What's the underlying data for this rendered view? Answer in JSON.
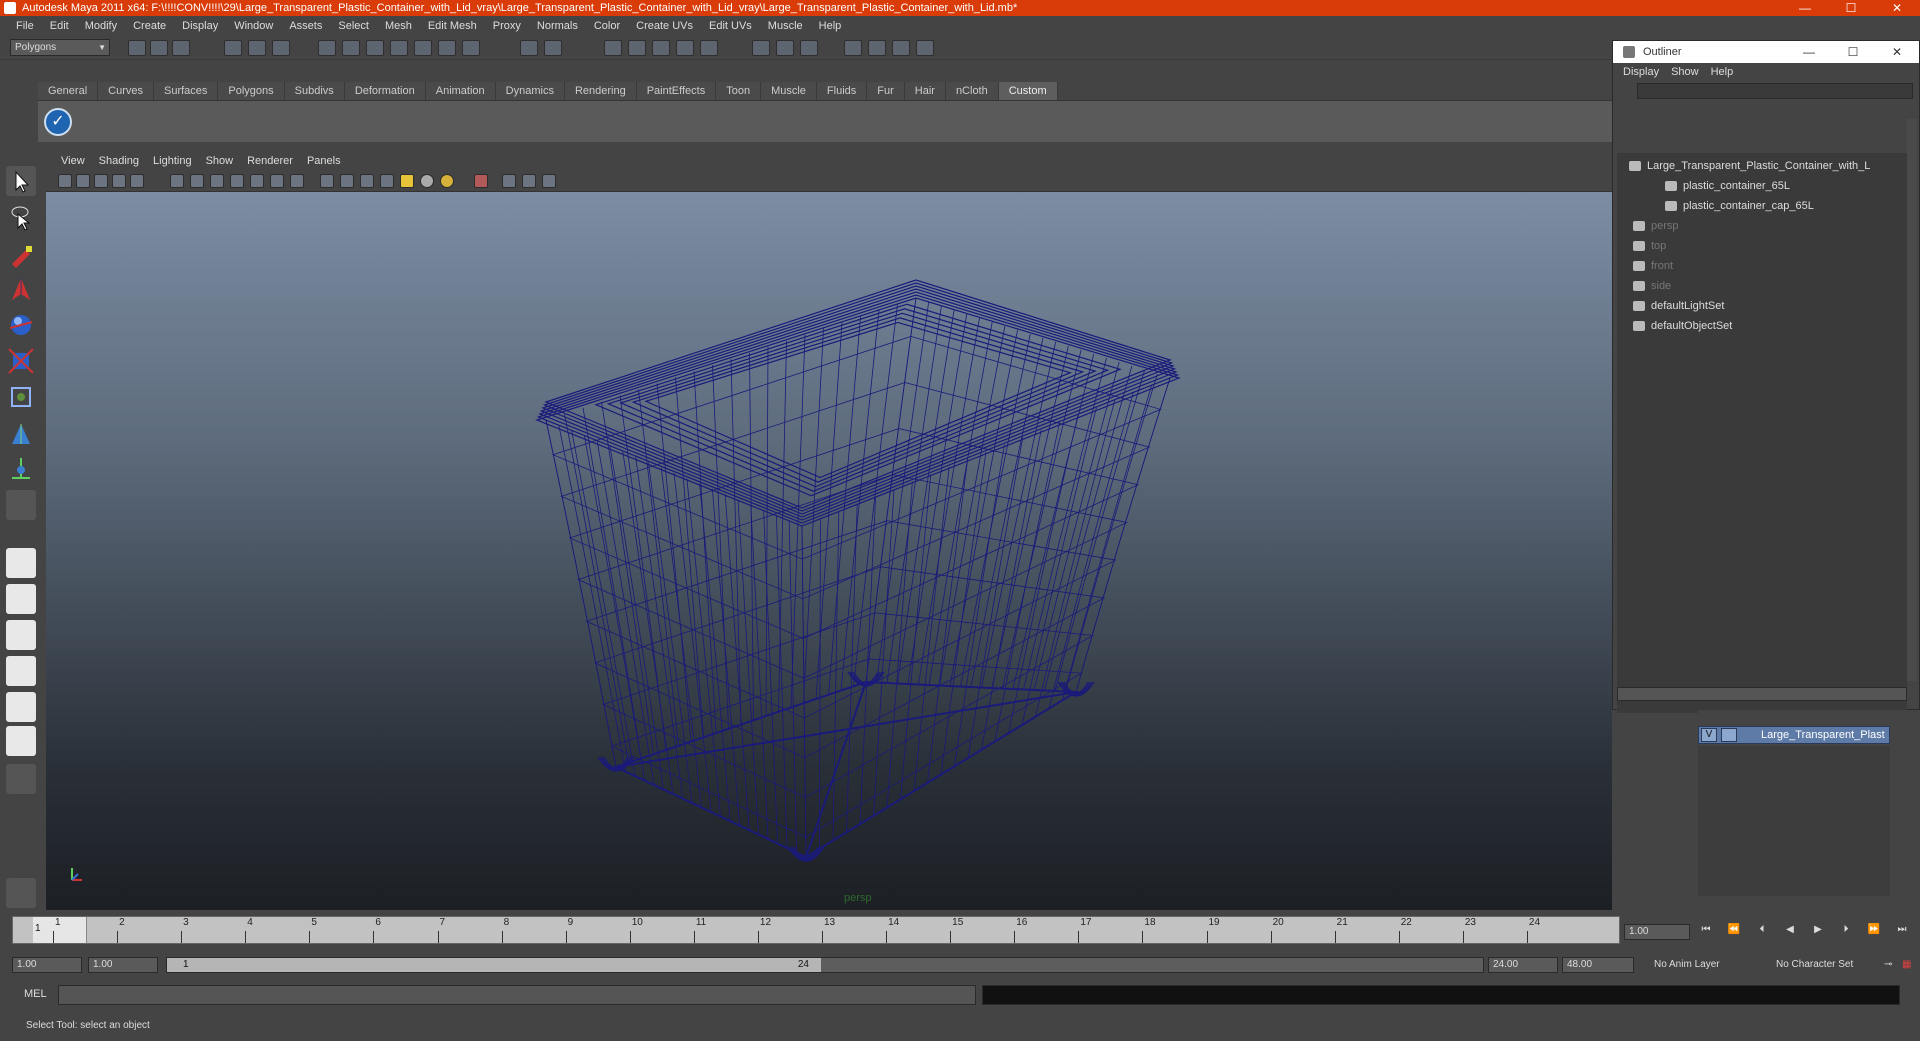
{
  "window": {
    "title": "Autodesk Maya 2011 x64: F:\\!!!!CONV!!!!\\29\\Large_Transparent_Plastic_Container_with_Lid_vray\\Large_Transparent_Plastic_Container_with_Lid_vray\\Large_Transparent_Plastic_Container_with_Lid.mb*",
    "controls": [
      "—",
      "☐",
      "✕"
    ]
  },
  "menubar": [
    "File",
    "Edit",
    "Modify",
    "Create",
    "Display",
    "Window",
    "Assets",
    "Select",
    "Mesh",
    "Edit Mesh",
    "Proxy",
    "Normals",
    "Color",
    "Create UVs",
    "Edit UVs",
    "Muscle",
    "Help"
  ],
  "statusline": {
    "mode": "Polygons"
  },
  "shelf": {
    "tabs": [
      "General",
      "Curves",
      "Surfaces",
      "Polygons",
      "Subdivs",
      "Deformation",
      "Animation",
      "Dynamics",
      "Rendering",
      "PaintEffects",
      "Toon",
      "Muscle",
      "Fluids",
      "Fur",
      "Hair",
      "nCloth",
      "Custom"
    ],
    "active_tab": "Custom",
    "icons": [
      "check-icon"
    ]
  },
  "panel": {
    "menus": [
      "View",
      "Shading",
      "Lighting",
      "Show",
      "Renderer",
      "Panels"
    ],
    "camera_label": "persp",
    "wire_color": "#1a1a7a"
  },
  "outliner": {
    "title": "Outliner",
    "menus": [
      "Display",
      "Show",
      "Help"
    ],
    "items": [
      {
        "label": "Large_Transparent_Plastic_Container_with_L",
        "icon": "group-icon",
        "dim": false
      },
      {
        "label": "plastic_container_65L",
        "icon": "mesh-icon",
        "dim": false
      },
      {
        "label": "plastic_container_cap_65L",
        "icon": "mesh-icon",
        "dim": false
      },
      {
        "label": "persp",
        "icon": "camera-icon",
        "dim": true
      },
      {
        "label": "top",
        "icon": "camera-icon",
        "dim": true
      },
      {
        "label": "front",
        "icon": "camera-icon",
        "dim": true
      },
      {
        "label": "side",
        "icon": "camera-icon",
        "dim": true
      },
      {
        "label": "defaultLightSet",
        "icon": "set-icon",
        "dim": false
      },
      {
        "label": "defaultObjectSet",
        "icon": "set-icon",
        "dim": false
      }
    ]
  },
  "layer_editor": {
    "layer": {
      "visible": "V",
      "name": "Large_Transparent_Plast"
    }
  },
  "timeline": {
    "ticks": [
      "1",
      "2",
      "3",
      "4",
      "5",
      "6",
      "7",
      "8",
      "9",
      "10",
      "11",
      "12",
      "13",
      "14",
      "15",
      "16",
      "17",
      "18",
      "19",
      "20",
      "21",
      "22",
      "23",
      "24"
    ],
    "current": "1",
    "current_frame_field": "1.00",
    "playback": [
      "⏮",
      "⏪",
      "⏴",
      "◀",
      "▶",
      "⏵",
      "⏩",
      "⏭"
    ]
  },
  "range": {
    "start_field": "1.00",
    "start_field2": "1.00",
    "slider_start": "1",
    "slider_end": "24",
    "end_field": "24.00",
    "end_field2": "48.00",
    "anim_layer": "No Anim Layer",
    "char_set": "No Character Set"
  },
  "command": {
    "label": "MEL"
  },
  "help_line": "Select Tool: select an object"
}
